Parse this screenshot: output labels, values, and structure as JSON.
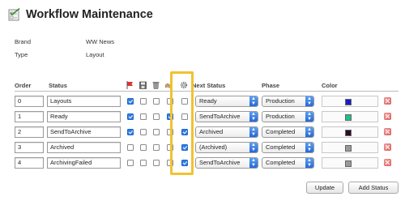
{
  "header": {
    "title": "Workflow Maintenance",
    "icon": "checklist-icon"
  },
  "meta": {
    "brand_label": "Brand",
    "brand_value": "WW News",
    "type_label": "Type",
    "type_value": "Layout"
  },
  "columns": {
    "order": "Order",
    "status": "Status",
    "next_status": "Next Status",
    "phase": "Phase",
    "color": "Color",
    "icons": [
      "flag-icon",
      "save-icon",
      "trash-icon",
      "handshake-icon",
      "gear-icon"
    ]
  },
  "rows": [
    {
      "order": "0",
      "status": "Layouts",
      "checks": [
        true,
        false,
        false,
        false,
        false
      ],
      "next_status": "Ready",
      "phase": "Production",
      "color": "#1a1acc"
    },
    {
      "order": "1",
      "status": "Ready",
      "checks": [
        true,
        false,
        false,
        true,
        false
      ],
      "next_status": "SendToArchive",
      "phase": "Production",
      "color": "#1fbf8f"
    },
    {
      "order": "2",
      "status": "SendToArchive",
      "checks": [
        true,
        false,
        false,
        false,
        true
      ],
      "next_status": "Archived",
      "phase": "Completed",
      "color": "#2a0a2a"
    },
    {
      "order": "3",
      "status": "Archived",
      "checks": [
        false,
        false,
        false,
        false,
        true
      ],
      "next_status": "(Archived)",
      "phase": "Completed",
      "color": "#999999"
    },
    {
      "order": "4",
      "status": "ArchivingFailed",
      "checks": [
        false,
        false,
        false,
        false,
        true
      ],
      "next_status": "SendToArchive",
      "phase": "Completed",
      "color": "#999999"
    }
  ],
  "buttons": {
    "update": "Update",
    "add_status": "Add Status"
  },
  "colors": {
    "highlight": "#f2c230",
    "checkbox_on": "#2f7ee6",
    "delete": "#d9534f"
  }
}
